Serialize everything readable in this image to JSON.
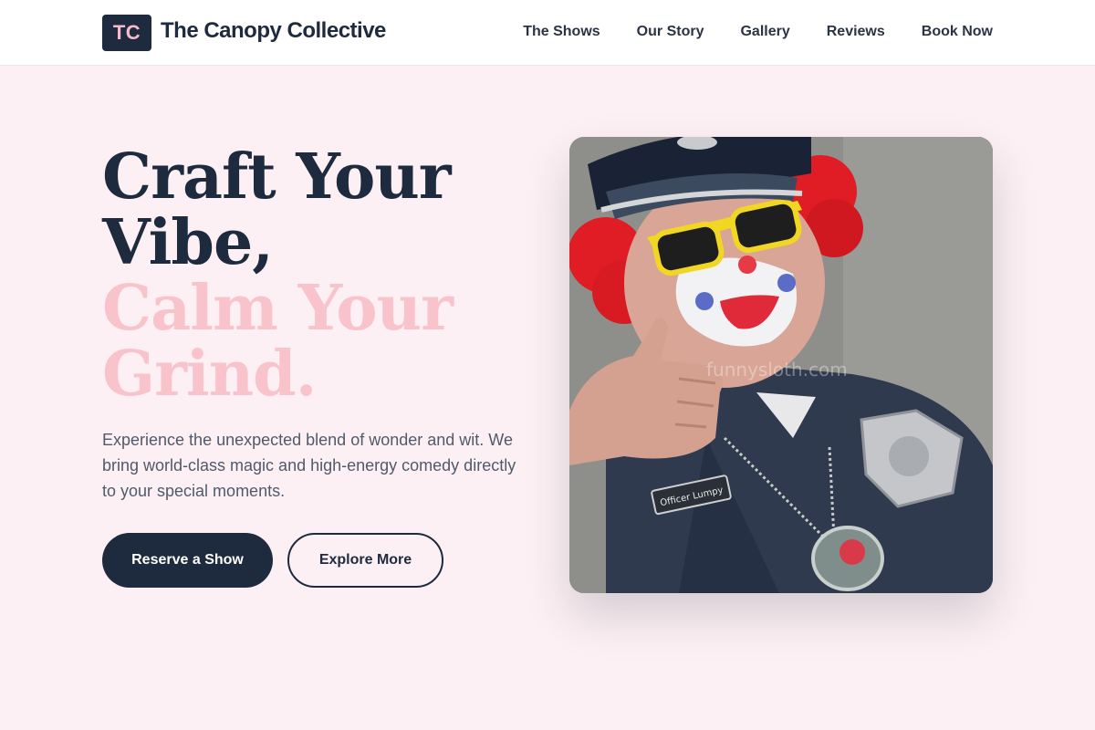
{
  "brand": {
    "initials": "TC",
    "name": "The Canopy Collective"
  },
  "nav": {
    "items": [
      {
        "label": "The Shows"
      },
      {
        "label": "Our Story"
      },
      {
        "label": "Gallery"
      },
      {
        "label": "Reviews"
      },
      {
        "label": "Book Now"
      }
    ]
  },
  "hero": {
    "title_line1": "Craft Your",
    "title_line2": "Vibe,",
    "title_line3": "Calm Your",
    "title_line4": "Grind.",
    "description": "Experience the unexpected blend of wonder and wit. We bring world-class magic and high-energy comedy directly to your special moments.",
    "primary_button": "Reserve a Show",
    "secondary_button": "Explore More",
    "image_watermark": "funnysloth.com",
    "name_tag": "Officer Lumpy"
  },
  "colors": {
    "navy": "#1e2a3d",
    "pink": "#f9c3cc",
    "background": "#fdf0f4"
  }
}
